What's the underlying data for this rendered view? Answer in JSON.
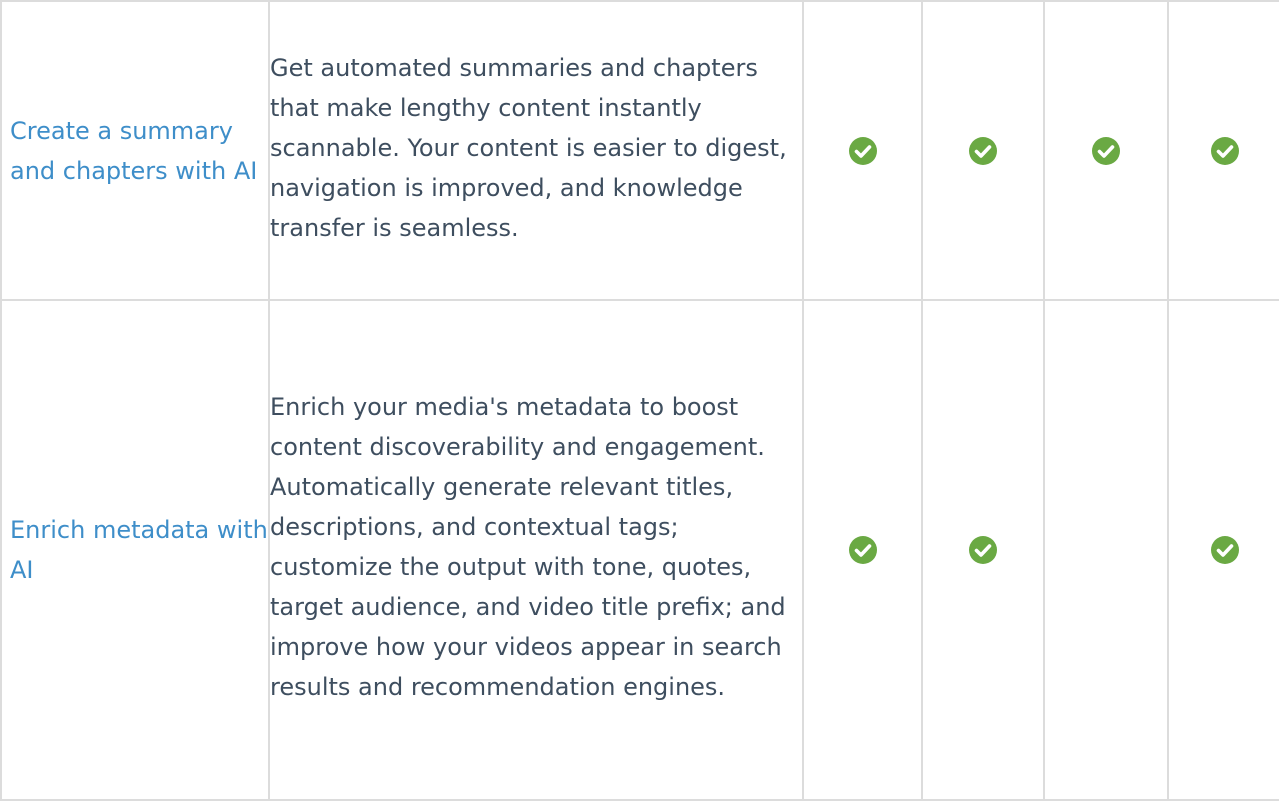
{
  "colors": {
    "feature_link": "#3e8ec9",
    "description_text": "#3e4e5f",
    "check_green": "#6aa943",
    "border": "#dcdcdc"
  },
  "rows": [
    {
      "feature": "Create a summary and chapters with AI",
      "description": "Get automated summaries and chapters that make lengthy content instantly scannable. Your content is easier to digest, navigation is improved, and knowledge transfer is seamless.",
      "checks": [
        true,
        true,
        true,
        true
      ]
    },
    {
      "feature": "Enrich metadata with AI",
      "description": "Enrich your media's metadata to boost content discoverability and engagement. Automatically generate relevant titles, descriptions, and contextual tags; customize the output with tone, quotes, target audience, and video title prefix; and improve how your videos appear in search results and recommendation engines.",
      "checks": [
        true,
        true,
        false,
        true
      ]
    }
  ],
  "icons": {
    "check": "check-circle-icon"
  }
}
